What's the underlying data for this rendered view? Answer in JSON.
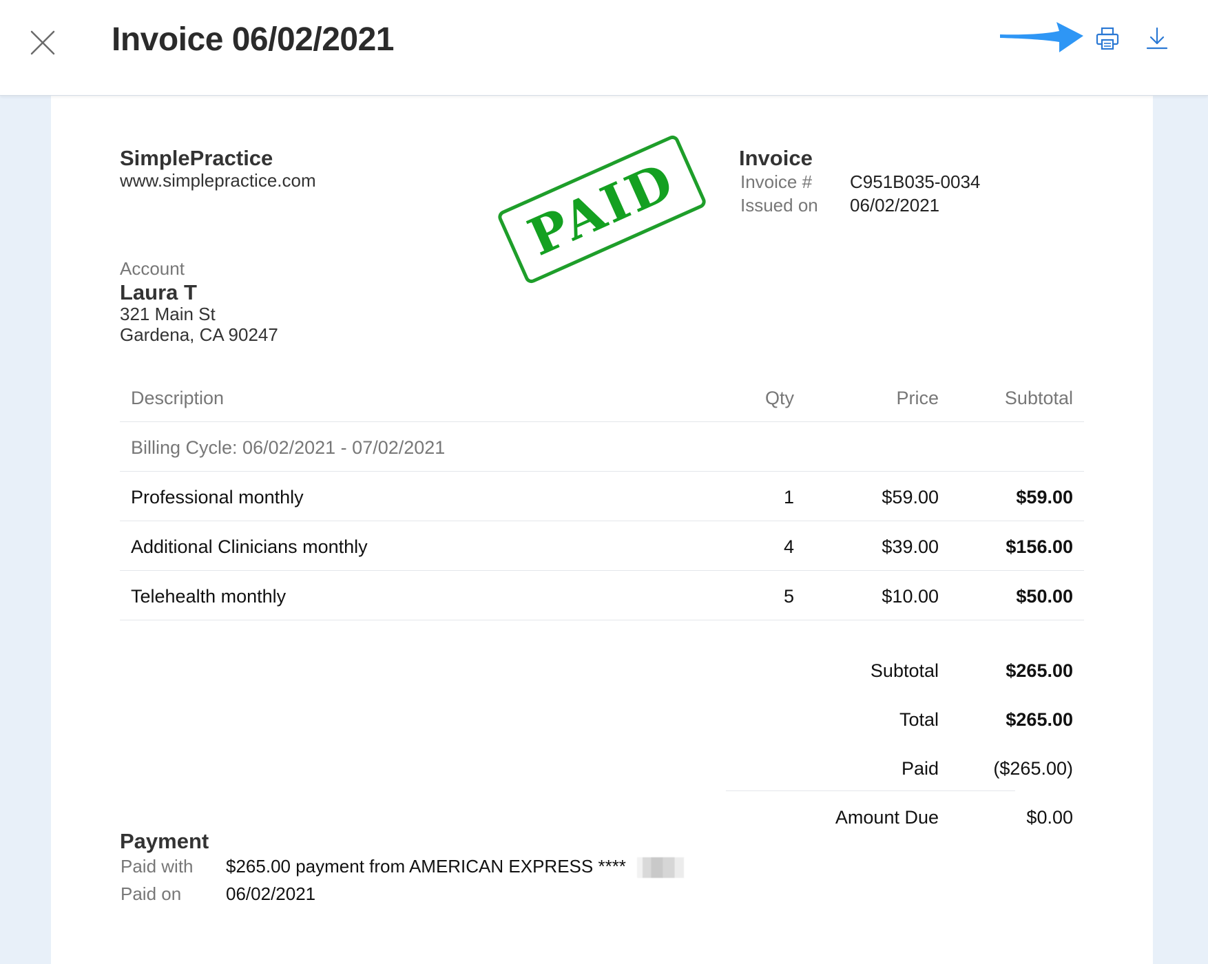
{
  "header": {
    "title": "Invoice 06/02/2021"
  },
  "colors": {
    "paper": "#ffffff",
    "background": "#e8f0f9",
    "stamp_green": "#14a021",
    "action_blue": "#2a78d4",
    "annotation_arrow": "#2e96f5"
  },
  "icons": {
    "close": "close-icon",
    "print": "printer-icon",
    "download": "download-icon",
    "annotation": "arrow-annotation"
  },
  "company": {
    "name": "SimplePractice",
    "website": "www.simplepractice.com"
  },
  "stamp": {
    "text": "PAID"
  },
  "invoice": {
    "heading": "Invoice",
    "number_label": "Invoice #",
    "number": "C951B035-0034",
    "issued_label": "Issued on",
    "issued_date": "06/02/2021"
  },
  "account": {
    "label": "Account",
    "name": "Laura T",
    "address_line1": "321 Main St",
    "address_line2": "Gardena, CA 90247"
  },
  "table": {
    "headers": {
      "description": "Description",
      "qty": "Qty",
      "price": "Price",
      "subtotal": "Subtotal"
    },
    "billing_cycle": "Billing Cycle: 06/02/2021 - 07/02/2021",
    "items": [
      {
        "description": "Professional monthly",
        "qty": "1",
        "price": "$59.00",
        "subtotal": "$59.00"
      },
      {
        "description": "Additional Clinicians monthly",
        "qty": "4",
        "price": "$39.00",
        "subtotal": "$156.00"
      },
      {
        "description": "Telehealth monthly",
        "qty": "5",
        "price": "$10.00",
        "subtotal": "$50.00"
      }
    ]
  },
  "totals": {
    "subtotal_label": "Subtotal",
    "subtotal": "$265.00",
    "total_label": "Total",
    "total": "$265.00",
    "paid_label": "Paid",
    "paid": "($265.00)",
    "amount_due_label": "Amount Due",
    "amount_due": "$0.00"
  },
  "payment": {
    "heading": "Payment",
    "paid_with_label": "Paid with",
    "paid_with": "$265.00 payment from AMERICAN EXPRESS ****",
    "paid_on_label": "Paid on",
    "paid_on": "06/02/2021"
  }
}
